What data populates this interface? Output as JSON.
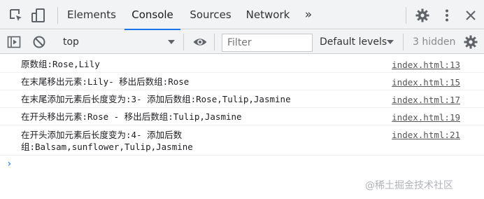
{
  "tabs": [
    {
      "label": "Elements"
    },
    {
      "label": "Console"
    },
    {
      "label": "Sources"
    },
    {
      "label": "Network"
    }
  ],
  "more_tabs": "»",
  "toolbar": {
    "context": "top",
    "filter_placeholder": "Filter",
    "levels": "Default levels",
    "hidden": "3 hidden"
  },
  "messages": [
    {
      "text": "原数组:Rose,Lily",
      "source": "index.html:13"
    },
    {
      "text": "在末尾移出元素:Lily- 移出后数组:Rose",
      "source": "index.html:15"
    },
    {
      "text": "在末尾添加元素后长度变为:3- 添加后数组:Rose,Tulip,Jasmine",
      "source": "index.html:17"
    },
    {
      "text": "在开头移出元素:Rose - 移出后数组:Tulip,Jasmine",
      "source": "index.html:19"
    },
    {
      "text": "在开头添加元素后长度变为:4- 添加后数\n组:Balsam,sunflower,Tulip,Jasmine",
      "source": "index.html:21"
    }
  ],
  "prompt": "›",
  "watermark": "@稀土掘金技术社区"
}
